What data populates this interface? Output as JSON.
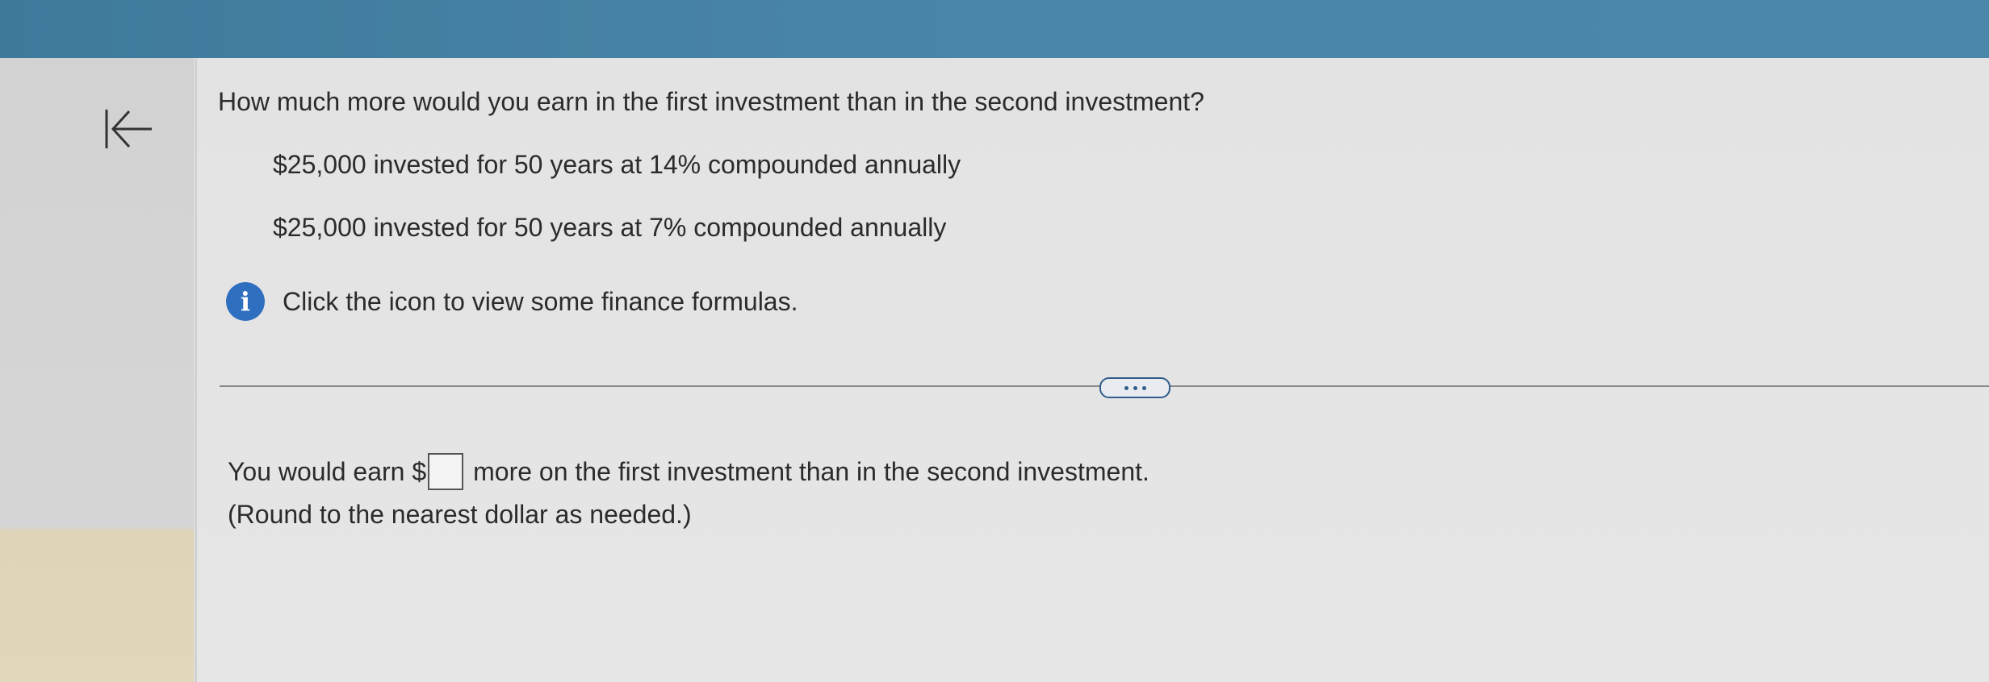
{
  "header": {
    "back_icon": "first-page-arrow-icon",
    "colors": {
      "top_band": "#4a86a8",
      "info_icon": "#2f6fbf"
    }
  },
  "question": {
    "prompt": "How much more would you earn in the first investment than in the second investment?",
    "investment_1": "$25,000 invested for 50 years at 14% compounded annually",
    "investment_2": "$25,000 invested for 50 years at 7% compounded annually",
    "info_icon_glyph": "i",
    "info_text": "Click the icon to view some finance formulas."
  },
  "answer": {
    "prefix": "You would earn $",
    "input_value": "",
    "suffix": "more on the first investment than in the second investment.",
    "hint": "(Round to the nearest dollar as needed.)"
  }
}
